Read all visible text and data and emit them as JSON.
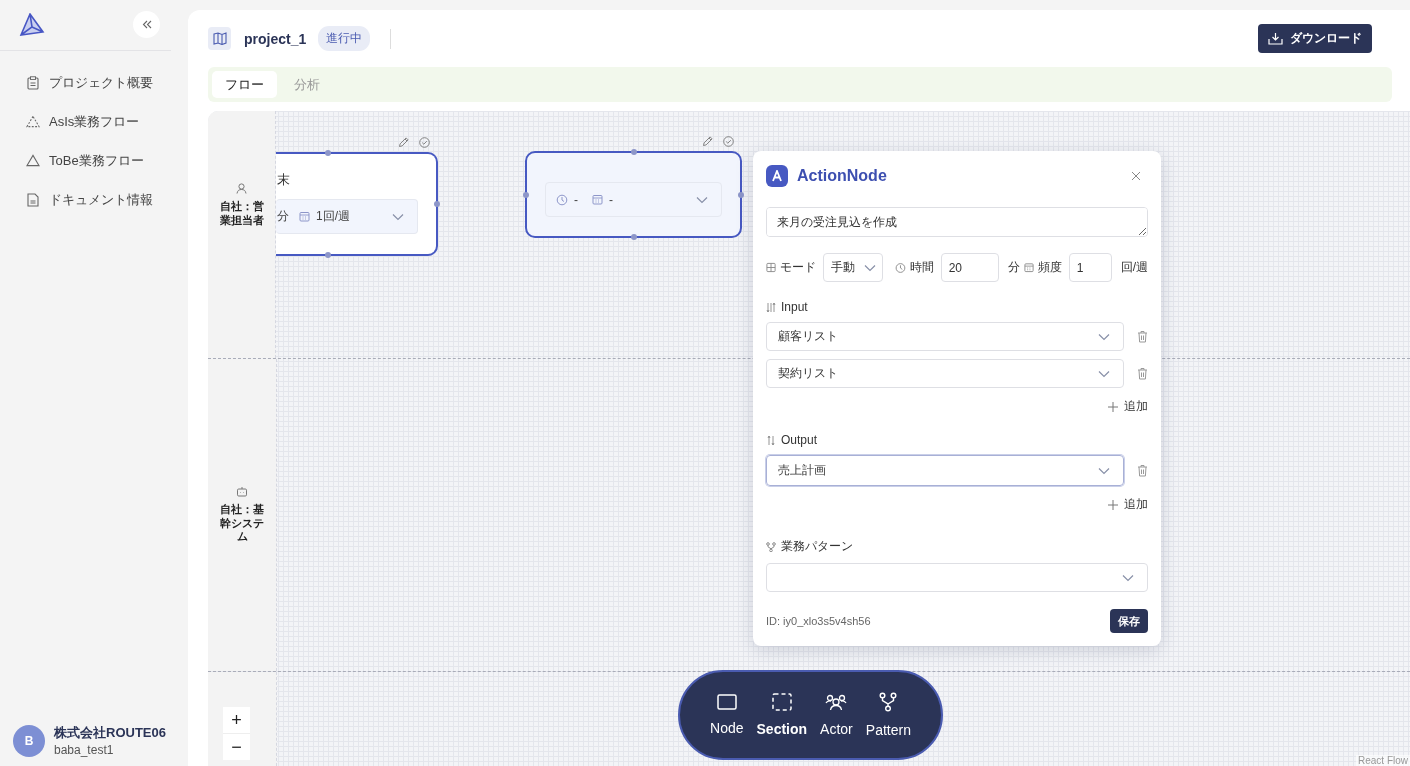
{
  "sidebar": {
    "items": [
      {
        "label": "プロジェクト概要",
        "selected": false
      },
      {
        "label": "AsIs業務フロー",
        "selected": false
      },
      {
        "label": "ToBe業務フロー",
        "selected": false
      },
      {
        "label": "ドキュメント情報",
        "selected": false
      }
    ],
    "user": {
      "avatar": "B",
      "organization": "株式会社ROUTE06",
      "username": "baba_test1"
    }
  },
  "header": {
    "project": "project_1",
    "status": "進行中",
    "download_button": "ダウンロード"
  },
  "tabs": [
    {
      "label": "フロー",
      "selected": true
    },
    {
      "label": "分析",
      "selected": false
    }
  ],
  "lanes": [
    {
      "label": "自社：営業担当者"
    },
    {
      "label": "自社：基幹システム"
    }
  ],
  "nodes": [
    {
      "text": "末",
      "time": "分",
      "frequency": "1回/週",
      "selected": false
    },
    {
      "time": "-",
      "frequency": "-",
      "selected": true
    }
  ],
  "panel": {
    "title": "ActionNode",
    "description": "来月の受注見込を作成",
    "mode_label": "モード",
    "mode": "手動",
    "time_label": "時間",
    "time": "20",
    "time_unit": "分",
    "frequency_label": "頻度",
    "frequency": "1",
    "frequency_unit": "回/週",
    "input_label": "Input",
    "inputs": [
      {
        "value": "顧客リスト",
        "focused": false
      },
      {
        "value": "契約リスト",
        "focused": false
      }
    ],
    "input_add": "追加",
    "output_label": "Output",
    "outputs": [
      {
        "value": "売上計画",
        "focused": true
      }
    ],
    "output_add": "追加",
    "pattern_label": "業務パターン",
    "id": "ID: iy0_xlo3s5v4sh56",
    "save_button": "保存"
  },
  "zoom": {
    "in": "+",
    "out": "−"
  },
  "toolbar": [
    {
      "label": "Node",
      "selected": false
    },
    {
      "label": "Section",
      "selected": true
    },
    {
      "label": "Actor",
      "selected": false
    },
    {
      "label": "Pattern",
      "selected": false
    }
  ],
  "attribution": "React Flow"
}
